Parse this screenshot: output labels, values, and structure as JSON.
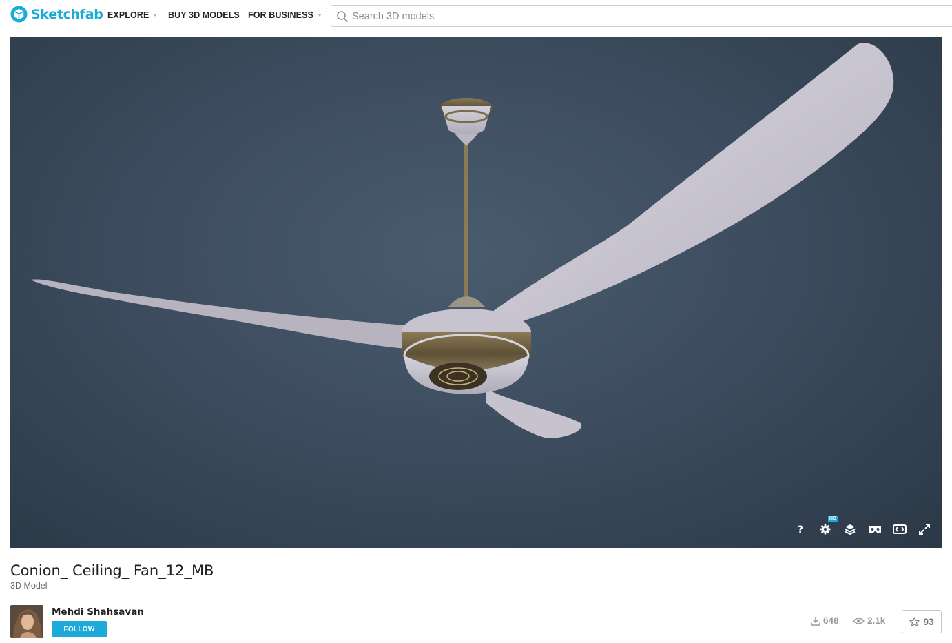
{
  "brand": {
    "name": "Sketchfab",
    "color": "#1caad9"
  },
  "nav": {
    "explore": "EXPLORE",
    "buy": "BUY 3D MODELS",
    "business": "FOR BUSINESS"
  },
  "search": {
    "placeholder": "Search 3D models"
  },
  "viewer": {
    "controls": [
      "help-icon",
      "settings-icon",
      "layers-icon",
      "vr-icon",
      "embed-icon",
      "fullscreen-icon"
    ],
    "hd_badge": "HD"
  },
  "model": {
    "title": "Conion_ Ceiling_ Fan_12_MB",
    "type": "3D Model"
  },
  "author": {
    "name": "Mehdi Shahsavan",
    "follow_label": "FOLLOW"
  },
  "stats": {
    "downloads": "648",
    "views": "2.1k",
    "likes": "93"
  }
}
